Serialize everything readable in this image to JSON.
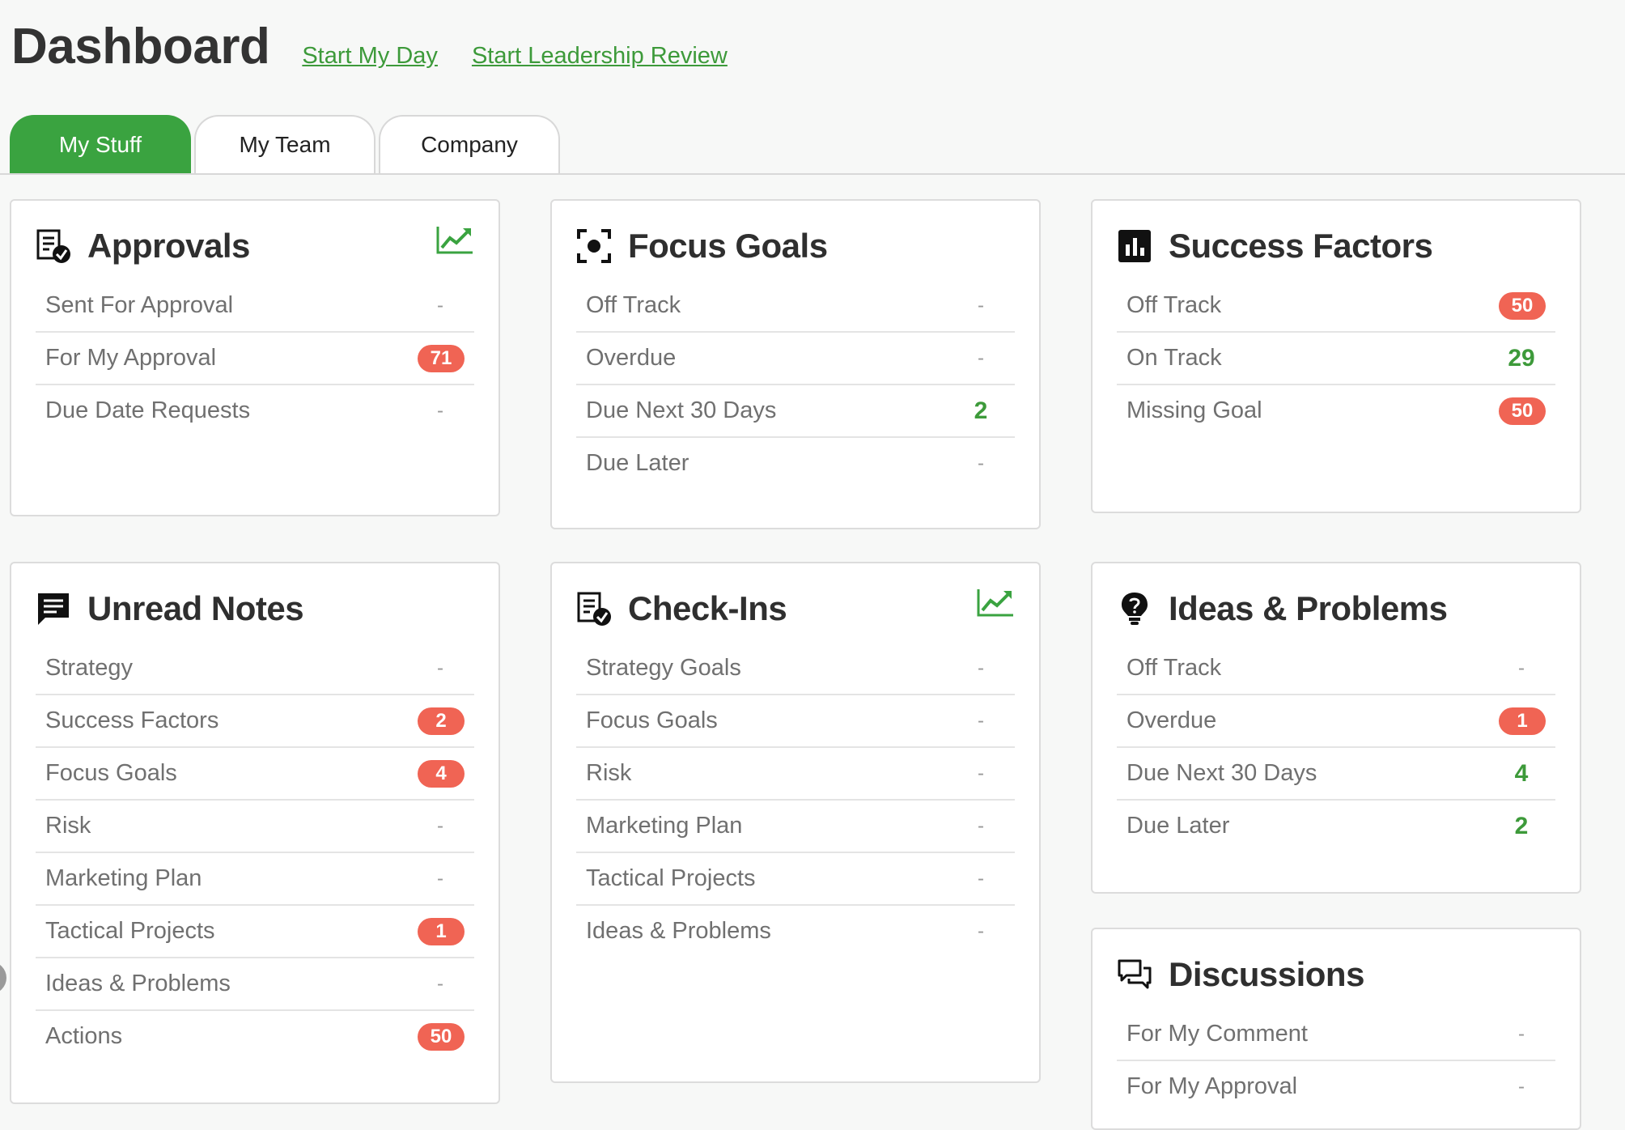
{
  "header": {
    "title": "Dashboard",
    "links": [
      "Start My Day",
      "Start Leadership Review"
    ]
  },
  "tabs": [
    "My Stuff",
    "My Team",
    "Company"
  ],
  "colors": {
    "accent": "#3aa340",
    "badge": "#f06454",
    "count": "#3d9a3a"
  },
  "cards": {
    "approvals": {
      "title": "Approvals",
      "icon": "document-check-icon",
      "rows": [
        {
          "label": "Sent For Approval",
          "value": "-"
        },
        {
          "label": "For My Approval",
          "value": "71"
        },
        {
          "label": "Due Date Requests",
          "value": "-"
        }
      ]
    },
    "focus_goals": {
      "title": "Focus Goals",
      "icon": "focus-target-icon",
      "rows": [
        {
          "label": "Off Track",
          "value": "-"
        },
        {
          "label": "Overdue",
          "value": "-"
        },
        {
          "label": "Due Next 30 Days",
          "value": "2"
        },
        {
          "label": "Due Later",
          "value": "-"
        }
      ]
    },
    "success_factors": {
      "title": "Success Factors",
      "icon": "bar-chart-icon",
      "rows": [
        {
          "label": "Off Track",
          "value": "50"
        },
        {
          "label": "On Track",
          "value": "29"
        },
        {
          "label": "Missing Goal",
          "value": "50"
        }
      ]
    },
    "unread_notes": {
      "title": "Unread Notes",
      "icon": "note-icon",
      "rows": [
        {
          "label": "Strategy",
          "value": "-"
        },
        {
          "label": "Success Factors",
          "value": "2"
        },
        {
          "label": "Focus Goals",
          "value": "4"
        },
        {
          "label": "Risk",
          "value": "-"
        },
        {
          "label": "Marketing Plan",
          "value": "-"
        },
        {
          "label": "Tactical Projects",
          "value": "1"
        },
        {
          "label": "Ideas & Problems",
          "value": "-"
        },
        {
          "label": "Actions",
          "value": "50"
        }
      ]
    },
    "check_ins": {
      "title": "Check-Ins",
      "icon": "document-check-icon",
      "rows": [
        {
          "label": "Strategy Goals",
          "value": "-"
        },
        {
          "label": "Focus Goals",
          "value": "-"
        },
        {
          "label": "Risk",
          "value": "-"
        },
        {
          "label": "Marketing Plan",
          "value": "-"
        },
        {
          "label": "Tactical Projects",
          "value": "-"
        },
        {
          "label": "Ideas & Problems",
          "value": "-"
        }
      ]
    },
    "ideas_problems": {
      "title": "Ideas & Problems",
      "icon": "question-bulb-icon",
      "rows": [
        {
          "label": "Off Track",
          "value": "-"
        },
        {
          "label": "Overdue",
          "value": "1"
        },
        {
          "label": "Due Next 30 Days",
          "value": "4"
        },
        {
          "label": "Due Later",
          "value": "2"
        }
      ]
    },
    "discussions": {
      "title": "Discussions",
      "icon": "chat-bubbles-icon",
      "rows": [
        {
          "label": "For My Comment",
          "value": "-"
        },
        {
          "label": "For My Approval",
          "value": "-"
        }
      ]
    }
  }
}
